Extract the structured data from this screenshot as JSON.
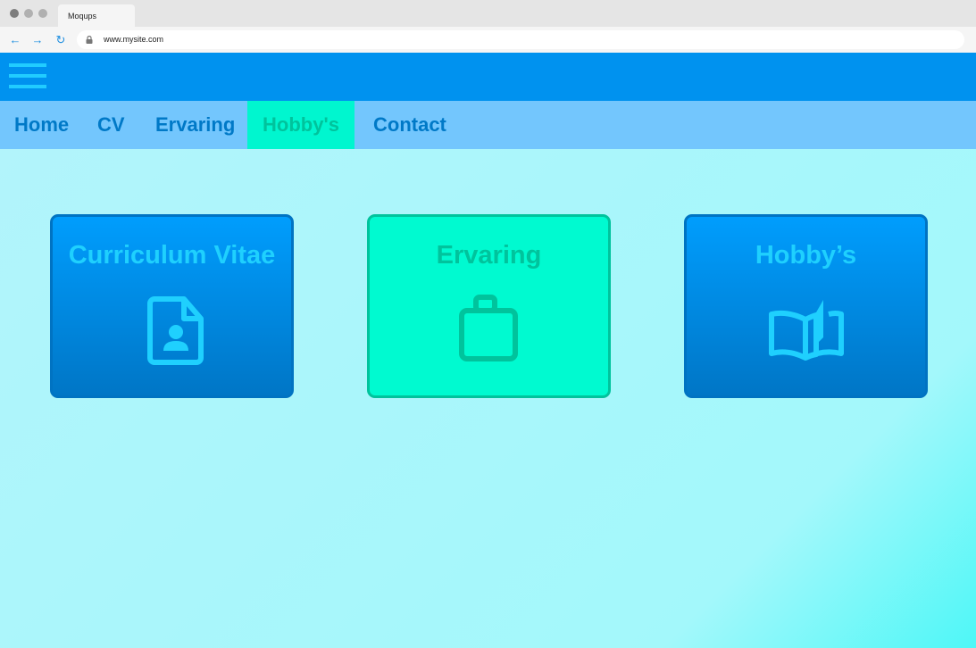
{
  "browser": {
    "tab_title": "Moqups",
    "url": "www.mysite.com",
    "back_glyph": "←",
    "forward_glyph": "→",
    "reload_glyph": "↻"
  },
  "nav": {
    "items": [
      {
        "label": "Home",
        "active": false
      },
      {
        "label": "CV",
        "active": false
      },
      {
        "label": "Ervaring",
        "active": false
      },
      {
        "label": "Hobby's",
        "active": true
      },
      {
        "label": "Contact",
        "active": false
      }
    ]
  },
  "cards": [
    {
      "title": "Curriculum Vitae",
      "icon": "contact-document-icon"
    },
    {
      "title": "Ervaring",
      "icon": "briefcase-icon"
    },
    {
      "title": "Hobby’s",
      "icon": "open-book-icon"
    }
  ],
  "colors": {
    "header": "#0092ef",
    "menubar": "#73c6fd",
    "active_tab": "#00f6cf",
    "nav_text": "#0079c7",
    "card_blue": "#009dfd",
    "card_green": "#00fad0",
    "accent_cyan": "#1fd0fe"
  }
}
